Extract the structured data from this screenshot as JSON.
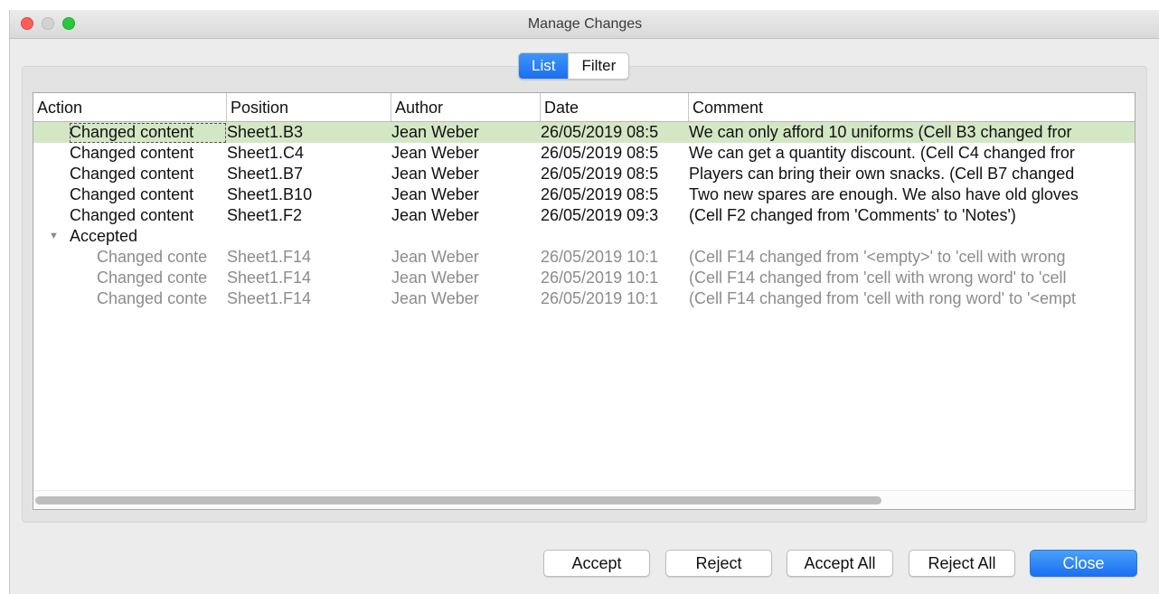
{
  "window": {
    "title": "Manage Changes"
  },
  "tabs": [
    {
      "label": "List",
      "active": true
    },
    {
      "label": "Filter",
      "active": false
    }
  ],
  "columns": [
    "Action",
    "Position",
    "Author",
    "Date",
    "Comment"
  ],
  "rows": [
    {
      "action": "Changed content",
      "position": "Sheet1.B3",
      "author": "Jean Weber",
      "date": "26/05/2019 08:5",
      "comment": "We can only afford 10 uniforms (Cell B3 changed fror"
    },
    {
      "action": "Changed content",
      "position": "Sheet1.C4",
      "author": "Jean Weber",
      "date": "26/05/2019 08:5",
      "comment": "We can get a quantity discount. (Cell C4 changed fror"
    },
    {
      "action": "Changed content",
      "position": "Sheet1.B7",
      "author": "Jean Weber",
      "date": "26/05/2019 08:5",
      "comment": "Players can bring their own snacks. (Cell B7 changed"
    },
    {
      "action": "Changed content",
      "position": "Sheet1.B10",
      "author": "Jean Weber",
      "date": "26/05/2019 08:5",
      "comment": "Two new spares are enough. We also have old gloves"
    },
    {
      "action": "Changed content",
      "position": "Sheet1.F2",
      "author": "Jean Weber",
      "date": "26/05/2019 09:3",
      "comment": " (Cell F2 changed from 'Comments' to 'Notes')"
    }
  ],
  "accepted_group": {
    "label": "Accepted",
    "rows": [
      {
        "action": "Changed conte",
        "position": "Sheet1.F14",
        "author": "Jean Weber",
        "date": "26/05/2019 10:1",
        "comment": " (Cell F14 changed from '<empty>' to 'cell with wrong"
      },
      {
        "action": "Changed conte",
        "position": "Sheet1.F14",
        "author": "Jean Weber",
        "date": "26/05/2019 10:1",
        "comment": " (Cell F14 changed from 'cell with wrong word' to 'cell"
      },
      {
        "action": "Changed conte",
        "position": "Sheet1.F14",
        "author": "Jean Weber",
        "date": "26/05/2019 10:1",
        "comment": " (Cell F14 changed from 'cell with rong word' to '<empt"
      }
    ]
  },
  "buttons": {
    "accept": "Accept",
    "reject": "Reject",
    "accept_all": "Accept All",
    "reject_all": "Reject All",
    "close": "Close"
  },
  "icons": {
    "disclosure": "disclosure-triangle-down-icon"
  },
  "colors": {
    "selected_row": "#d4e7c5",
    "accent": "#1a6ff2"
  }
}
